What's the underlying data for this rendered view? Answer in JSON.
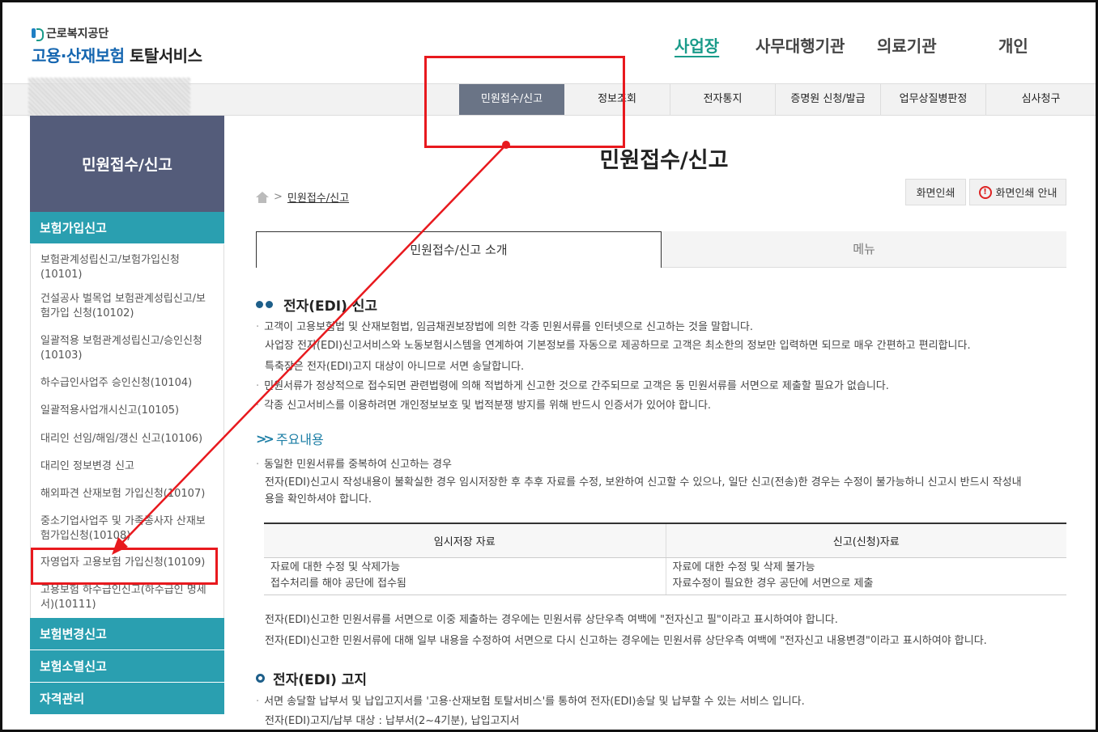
{
  "header": {
    "org_name": "근로복지공단",
    "service_name_part1": "고용·산재보험",
    "service_name_part2": "토탈서비스",
    "nav": [
      {
        "label": "사업장",
        "active": true
      },
      {
        "label": "사무대행기관",
        "active": false
      },
      {
        "label": "의료기관",
        "active": false
      },
      {
        "label": "개인",
        "active": false
      }
    ]
  },
  "gnb": {
    "items": [
      {
        "label": "민원접수/신고",
        "active": true
      },
      {
        "label": "정보조회",
        "active": false
      },
      {
        "label": "전자통지",
        "active": false
      },
      {
        "label": "증명원 신청/발급",
        "active": false
      },
      {
        "label": "업무상질병판정",
        "active": false
      },
      {
        "label": "심사청구",
        "active": false
      }
    ]
  },
  "sidebar": {
    "title": "민원접수/신고",
    "groups": [
      {
        "label": "보험가입신고"
      },
      {
        "label": "보험변경신고"
      },
      {
        "label": "보험소멸신고"
      },
      {
        "label": "자격관리"
      }
    ],
    "items": [
      {
        "label": "보험관계성립신고/보험가입신청(10101)"
      },
      {
        "label": "건설공사 벌목업 보험관계성립신고/보험가입 신청(10102)"
      },
      {
        "label": "일괄적용 보험관계성립신고/승인신청(10103)"
      },
      {
        "label": "하수급인사업주 승인신청(10104)"
      },
      {
        "label": "일괄적용사업개시신고(10105)"
      },
      {
        "label": "대리인 선임/해임/갱신 신고(10106)"
      },
      {
        "label": "대리인 정보변경 신고"
      },
      {
        "label": "해외파견 산재보험 가입신청(10107)"
      },
      {
        "label": "중소기업사업주 및 가족종사자 산재보험가입신청(10108)"
      },
      {
        "label": "자영업자 고용보험 가입신청(10109)"
      },
      {
        "label": "고용보험 하수급인신고(하수급인 명세서)(10111)"
      }
    ]
  },
  "main": {
    "page_title": "민원접수/신고",
    "breadcrumb": "민원접수/신고",
    "print_button": "화면인쇄",
    "print_guide_button": "화면인쇄 안내",
    "tabs": [
      {
        "label": "민원접수/신고 소개",
        "active": true
      },
      {
        "label": "메뉴",
        "active": false
      }
    ],
    "section1": {
      "heading": "전자(EDI) 신고",
      "lines": [
        "고객이 고용보험법 및 산재보험법, 임금채권보장법에 의한 각종 민원서류를 인터넷으로 신고하는 것을 말합니다.",
        "사업장 전자(EDI)신고서비스와 노동보험시스템을 연계하여 기본정보를 자동으로 제공하므로 고객은 최소한의 정보만 입력하면 되므로 매우 간편하고 편리합니다.",
        "특축장은 전자(EDI)고지 대상이 아니므로 서면 송달합니다.",
        "민원서류가 정상적으로 접수되면 관련법령에 의해 적법하게 신고한 것으로 간주되므로 고객은 동 민원서류를 서면으로 제출할 필요가 없습니다.",
        "각종 신고서비스를 이용하려면 개인정보보호 및 법적분쟁 방지를 위해 반드시 인증서가 있어야 합니다."
      ]
    },
    "sub_heading": "주요내용",
    "sub_lines": [
      "동일한 민원서류를 중복하여 신고하는 경우",
      "전자(EDI)신고시 작성내용이 불확실한 경우 임시저장한 후 추후 자료를 수정, 보완하여 신고할 수 있으나, 일단 신고(전송)한 경우는 수정이 불가능하니 신고시 반드시 작성내",
      "용을 확인하셔야 합니다."
    ],
    "table": {
      "headers": [
        "임시저장 자료",
        "신고(신청)자료"
      ],
      "rows": [
        [
          "자료에 대한 수정 및 삭제가능",
          "자료에 대한 수정 및 삭제 불가능"
        ],
        [
          "접수처리를 해야 공단에 접수됨",
          "자료수정이 필요한 경우 공단에 서면으로 제출"
        ]
      ]
    },
    "notes": [
      "전자(EDI)신고한 민원서류를 서면으로 이중 제출하는 경우에는 민원서류 상단우측 여백에 \"전자신고 필\"이라고 표시하여야 합니다.",
      "전자(EDI)신고한 민원서류에 대해 일부 내용을 수정하여 서면으로 다시 신고하는 경우에는 민원서류 상단우측 여백에 \"전자신고 내용변경\"이라고 표시하여야 합니다."
    ],
    "section2": {
      "heading": "전자(EDI) 고지",
      "lines": [
        "서면 송달할 납부서 및 납입고지서를 '고용·산재보험 토탈서비스'를 통하여 전자(EDI)송달 및 납부할 수 있는 서비스 입니다.",
        "전자(EDI)고지/납부 대상 : 납부서(2~4기분), 납입고지서"
      ]
    }
  },
  "colors": {
    "accent_teal": "#2a9fb0",
    "sidebar_title_bg": "#545c7a",
    "gnb_active_bg": "#6a7486",
    "annotation_red": "#e8191e"
  }
}
